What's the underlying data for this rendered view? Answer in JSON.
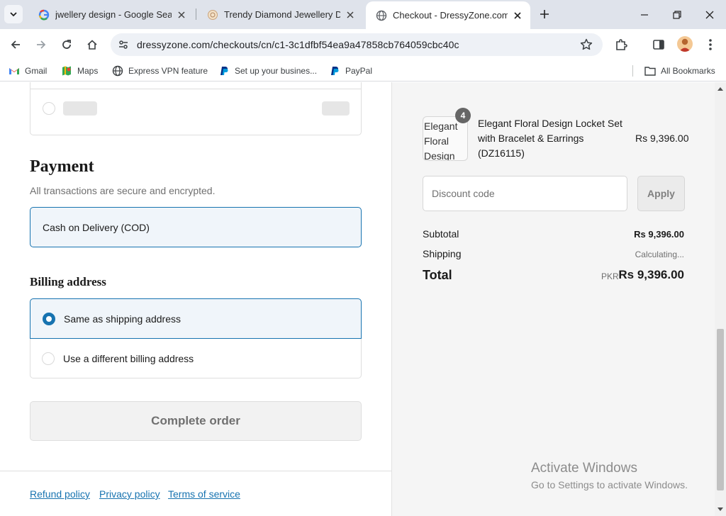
{
  "browser": {
    "tabs": [
      {
        "title": "jwellery design - Google Search",
        "favicon": "google-icon"
      },
      {
        "title": "Trendy Diamond Jewellery Desi",
        "favicon": "store-icon"
      },
      {
        "title": "Checkout - DressyZone.com",
        "favicon": "globe-icon"
      }
    ],
    "url": "dressyzone.com/checkouts/cn/c1-3c1dfbf54ea9a47858cb764059cbc40c",
    "bookmarks": [
      {
        "label": "Gmail",
        "icon": "gmail-icon"
      },
      {
        "label": "Maps",
        "icon": "maps-icon"
      },
      {
        "label": "Express VPN feature",
        "icon": "globe-icon"
      },
      {
        "label": "Set up your busines...",
        "icon": "paypal-icon"
      },
      {
        "label": "PayPal",
        "icon": "paypal-icon"
      }
    ],
    "all_bookmarks": "All Bookmarks"
  },
  "payment": {
    "heading": "Payment",
    "subtext": "All transactions are secure and encrypted.",
    "method": "Cash on Delivery (COD)"
  },
  "billing": {
    "heading": "Billing address",
    "options": [
      "Same as shipping address",
      "Use a different billing address"
    ],
    "selected": "Same as shipping address"
  },
  "complete_order": "Complete order",
  "footer_links": [
    "Refund policy",
    "Privacy policy",
    "Terms of service"
  ],
  "order_summary": {
    "item": {
      "name": "Elegant Floral Design Locket Set with Bracelet & Earrings (DZ16115)",
      "image_alt": "Elegant Floral Design",
      "quantity": "4",
      "price": "Rs 9,396.00"
    },
    "discount_placeholder": "Discount code",
    "apply_label": "Apply",
    "subtotal_label": "Subtotal",
    "subtotal_value": "Rs 9,396.00",
    "shipping_label": "Shipping",
    "shipping_value": "Calculating...",
    "total_label": "Total",
    "total_currency": "PKR",
    "total_value": "Rs 9,396.00"
  },
  "watermark": {
    "line1": "Activate Windows",
    "line2": "Go to Settings to activate Windows."
  },
  "colors": {
    "accent": "#1773b0",
    "selected_bg": "#f0f5fa",
    "tabbar": "#dfe3eb",
    "summary_bg": "#f5f5f5"
  }
}
